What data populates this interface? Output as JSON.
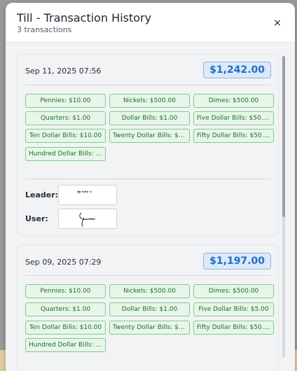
{
  "modal": {
    "title": "Till - Transaction History",
    "subtitle": "3 transactions",
    "close_label": "×"
  },
  "transactions": [
    {
      "date": "Sep 11, 2025 07:56",
      "amount": "$1,242.00",
      "denominations": [
        "Pennies: $10.00",
        "Nickels: $500.00",
        "Dimes: $500.00",
        "Quarters: $1.00",
        "Dollar Bills: $1.00",
        "Five Dollar Bills: $50.00",
        "Ten Dollar Bills: $10.00",
        "Twenty Dollar Bills: $20...",
        "Fifty Dollar Bills: $50.00",
        "Hundred Dollar Bills: $1..."
      ],
      "signatures": {
        "leader_label": "Leader:",
        "user_label": "User:"
      }
    },
    {
      "date": "Sep 09, 2025 07:29",
      "amount": "$1,197.00",
      "denominations": [
        "Pennies: $10.00",
        "Nickels: $500.00",
        "Dimes: $500.00",
        "Quarters: $1.00",
        "Dollar Bills: $1.00",
        "Five Dollar Bills: $5.00",
        "Ten Dollar Bills: $10.00",
        "Twenty Dollar Bills: $20...",
        "Fifty Dollar Bills: $50.00",
        "Hundred Dollar Bills: $1..."
      ]
    }
  ],
  "colors": {
    "amount_bg": "#dce9f8",
    "amount_text": "#1f6fc9",
    "chip_bg": "#e7f6e9",
    "chip_border": "#7fca8a",
    "chip_text": "#1d6e2a"
  }
}
